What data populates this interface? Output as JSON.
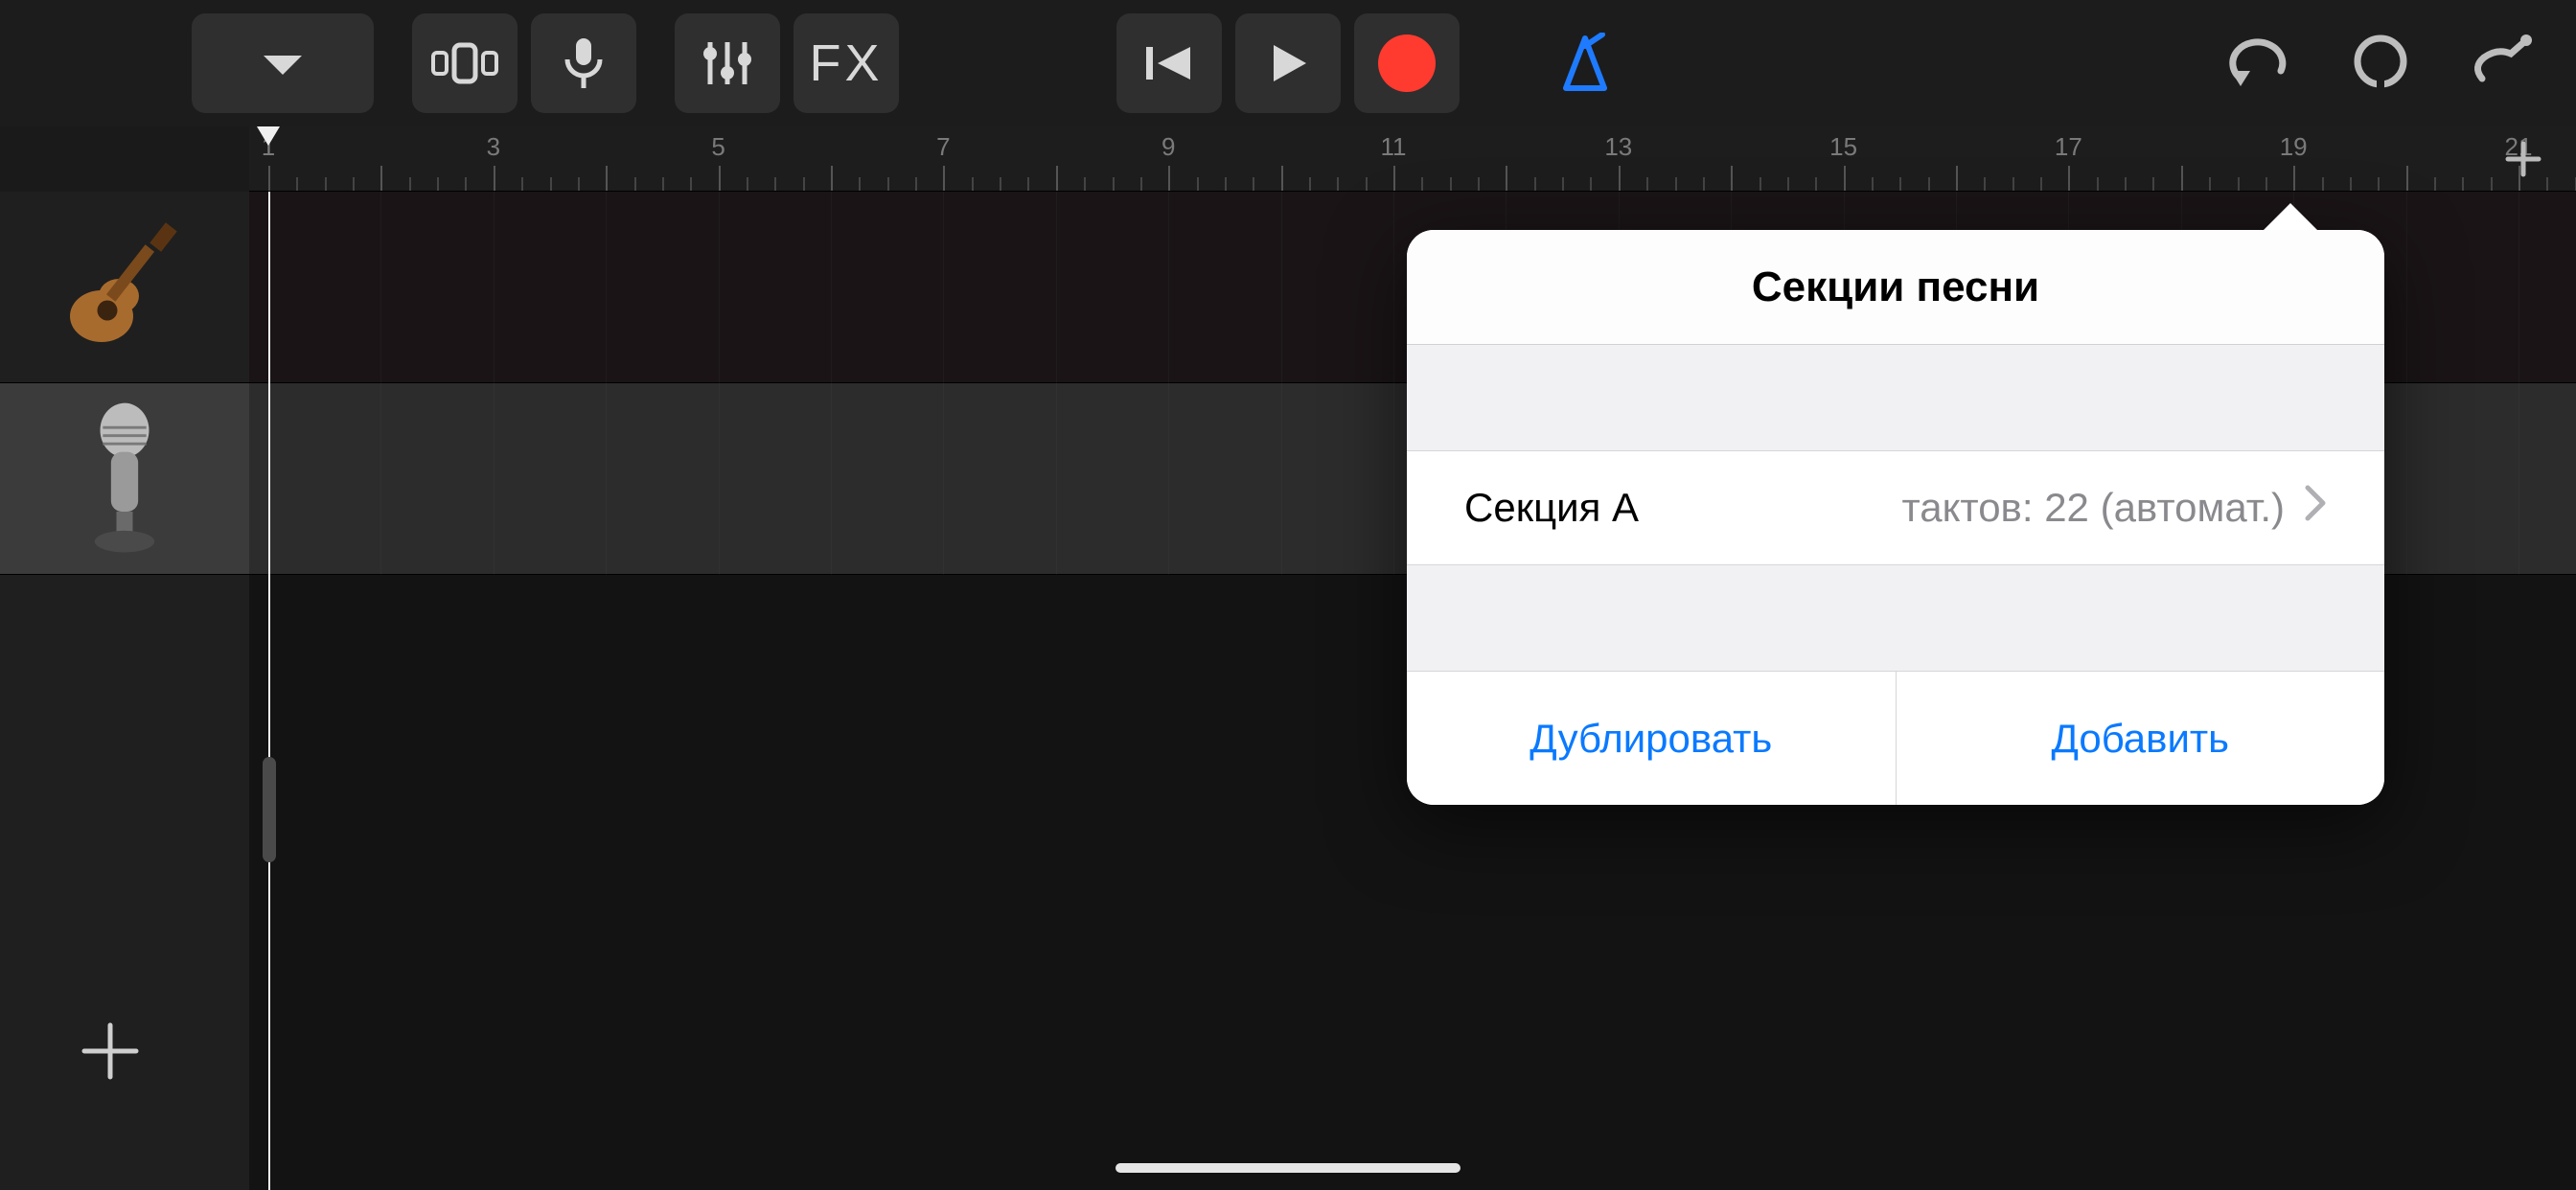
{
  "toolbar": {
    "fx_label": "FX"
  },
  "ruler": {
    "bar_numbers": [
      1,
      3,
      5,
      7,
      9,
      11,
      13,
      15,
      17,
      19,
      21
    ],
    "playhead_bar": 1
  },
  "tracks": [
    {
      "icon": "guitar",
      "selected": false
    },
    {
      "icon": "mic",
      "selected": true
    }
  ],
  "popover": {
    "title": "Секции песни",
    "section_name": "Секция A",
    "section_detail": "тактов: 22 (автомат.)",
    "duplicate_label": "Дублировать",
    "add_label": "Добавить"
  }
}
